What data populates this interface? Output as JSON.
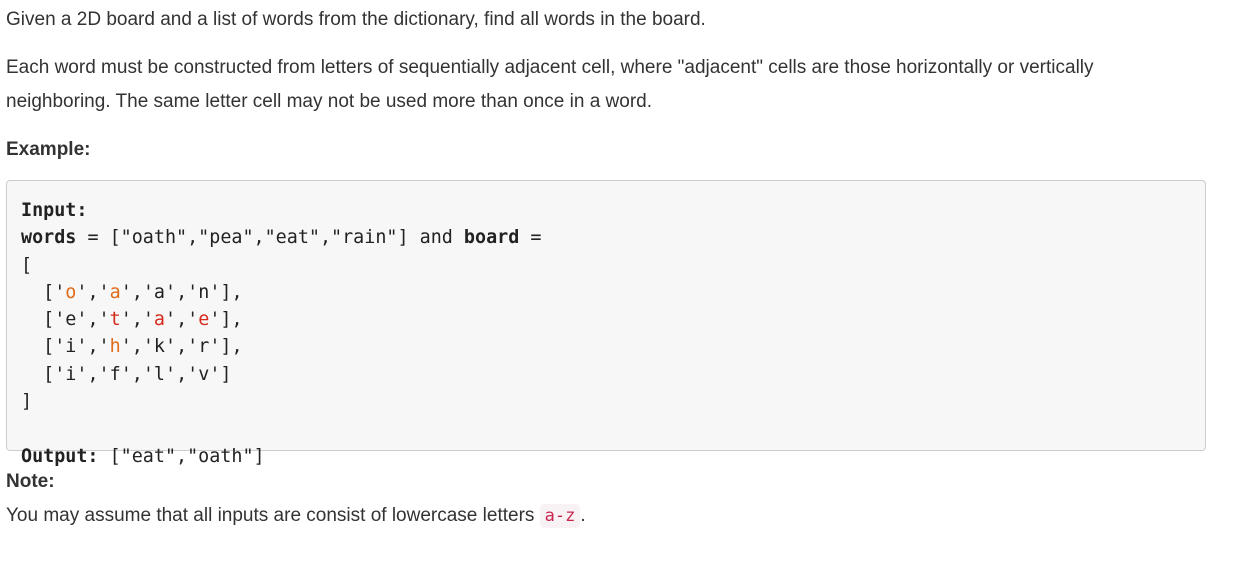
{
  "description_p1": "Given a 2D board and a list of words from the dictionary, find all words in the board.",
  "description_p2_line1": "Each word must be constructed from letters of sequentially adjacent cell, where \"adjacent\" cells are those horizontally or vertically",
  "description_p2_line2": "neighboring. The same letter cell may not be used more than once in a word.",
  "example_heading": "Example:",
  "code": {
    "input_label": "Input:",
    "words_label": "words",
    "equals1": " = ",
    "words_value": "[\"oath\",\"pea\",\"eat\",\"rain\"]",
    "and_text": " and ",
    "board_label": "board",
    "equals2": " =",
    "open_bracket": "[",
    "close_bracket": "]",
    "row_prefix": "  [",
    "row_suffix_comma": "],",
    "row_suffix_last": "]",
    "separator": ",",
    "quote": "'",
    "board": [
      [
        {
          "ch": "o",
          "hl": "orange"
        },
        {
          "ch": "a",
          "hl": "orange"
        },
        {
          "ch": "a",
          "hl": ""
        },
        {
          "ch": "n",
          "hl": ""
        }
      ],
      [
        {
          "ch": "e",
          "hl": ""
        },
        {
          "ch": "t",
          "hl": "red"
        },
        {
          "ch": "a",
          "hl": "red"
        },
        {
          "ch": "e",
          "hl": "red"
        }
      ],
      [
        {
          "ch": "i",
          "hl": ""
        },
        {
          "ch": "h",
          "hl": "orange"
        },
        {
          "ch": "k",
          "hl": ""
        },
        {
          "ch": "r",
          "hl": ""
        }
      ],
      [
        {
          "ch": "i",
          "hl": ""
        },
        {
          "ch": "f",
          "hl": ""
        },
        {
          "ch": "l",
          "hl": ""
        },
        {
          "ch": "v",
          "hl": ""
        }
      ]
    ],
    "output_label": "Output:",
    "output_value": " [\"eat\",\"oath\"]"
  },
  "note_heading": "Note:",
  "note_text_prefix": "You may assume that all inputs are consist of lowercase letters ",
  "note_code": "a-z",
  "note_text_suffix": ".",
  "colors": {
    "highlight_orange": "#e06c1a",
    "highlight_red": "#d6291b",
    "inline_code": "#c7254e"
  }
}
